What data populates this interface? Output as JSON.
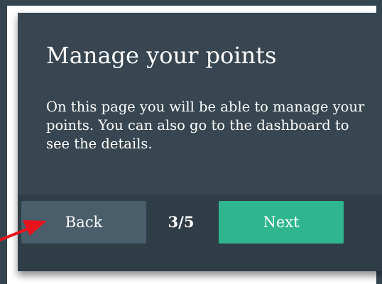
{
  "dialog": {
    "title": "Manage your points",
    "message": "On this page you will be able to manage your points. You can also go to the dashboard to see the details."
  },
  "footer": {
    "back_label": "Back",
    "step_counter": "3/5",
    "next_label": "Next"
  },
  "colors": {
    "backdrop": "#344550",
    "dialog_body": "#374650",
    "dialog_footer": "#2f3d46",
    "back_button": "#4a5d6b",
    "next_button": "#2fb68f",
    "annotation_arrow": "#e8141c"
  }
}
